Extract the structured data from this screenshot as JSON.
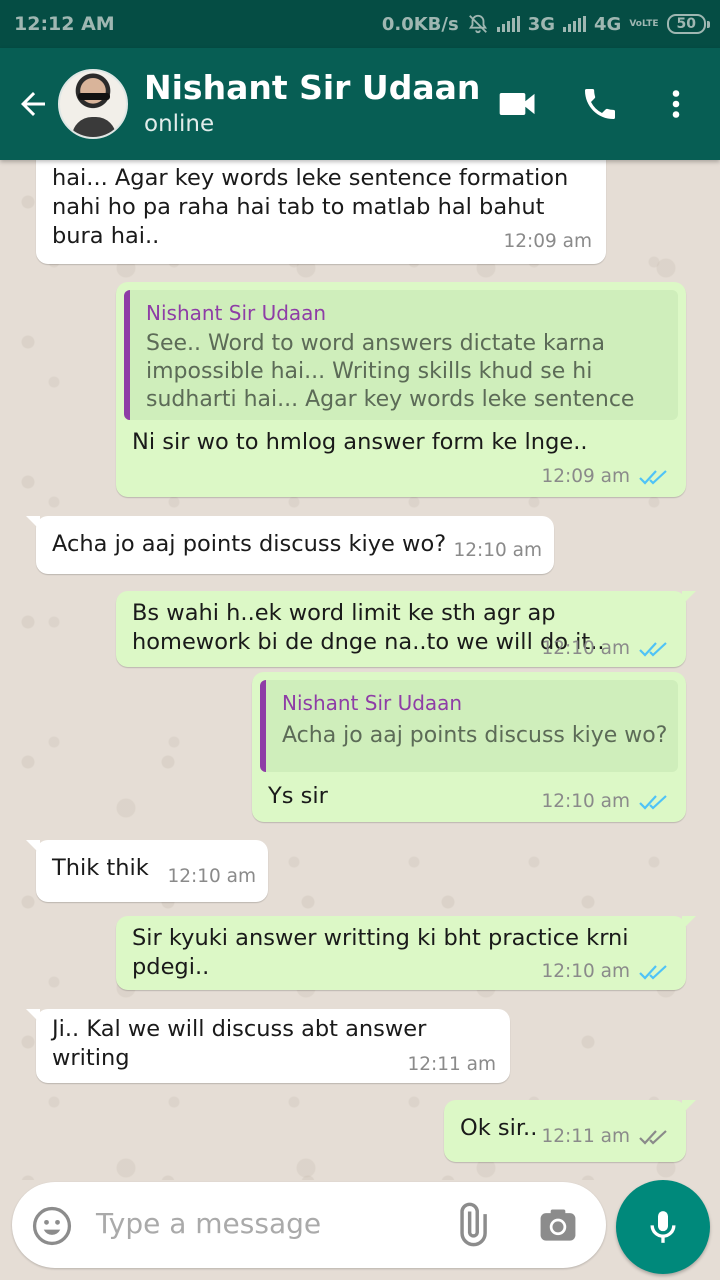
{
  "status_bar": {
    "time": "12:12 AM",
    "speed": "0.0KB/s",
    "network1": "3G",
    "network2": "4G",
    "volte": "VoLTE",
    "battery": "50"
  },
  "header": {
    "contact_name": "Nishant Sir Udaan",
    "status": "online"
  },
  "messages": [
    {
      "dir": "in",
      "text": "hai... Agar key words leke sentence formation nahi ho pa raha hai tab to matlab hal bahut bura hai..",
      "time": "12:09 am"
    },
    {
      "dir": "out",
      "quote_name": "Nishant Sir Udaan",
      "quote_text": "See.. Word to word answers dictate karna impossible hai... Writing skills khud se hi sudharti hai... Agar key words leke sentence fo...",
      "text": "Ni sir wo to hmlog answer form ke lnge..",
      "time": "12:09 am",
      "read": "read"
    },
    {
      "dir": "in",
      "text": "Acha jo aaj points discuss kiye wo?",
      "time": "12:10 am"
    },
    {
      "dir": "out",
      "text": "Bs wahi h..ek word limit ke sth agr ap homework bi de dnge na..to we will do it..",
      "time": "12:10 am",
      "read": "read"
    },
    {
      "dir": "out",
      "quote_name": "Nishant Sir Udaan",
      "quote_text": "Acha jo aaj points discuss kiye wo?",
      "text": "Ys sir",
      "time": "12:10 am",
      "read": "read"
    },
    {
      "dir": "in",
      "text": "Thik thik",
      "time": "12:10 am"
    },
    {
      "dir": "out",
      "text": "Sir kyuki answer writting ki bht practice krni pdegi..",
      "time": "12:10 am",
      "read": "read"
    },
    {
      "dir": "in",
      "text": "Ji.. Kal we will discuss abt answer writing",
      "time": "12:11 am"
    },
    {
      "dir": "out",
      "text": "Ok sir..",
      "time": "12:11 am",
      "read": "delivered"
    }
  ],
  "composer": {
    "placeholder": "Type a message"
  },
  "icons": {
    "back": "arrow-back-icon",
    "video": "video-call-icon",
    "call": "phone-icon",
    "more": "more-vert-icon",
    "emoji": "emoji-icon",
    "attach": "paperclip-icon",
    "camera": "camera-icon",
    "mic": "microphone-icon"
  },
  "colors": {
    "header": "#075e54",
    "status_bar": "#054d44",
    "outgoing_bubble": "#dcf8c6",
    "incoming_bubble": "#ffffff",
    "read_ticks": "#4fc3f7",
    "delivered_ticks": "#8a8a8a",
    "quote_accent": "#8e3da6",
    "mic_button": "#00897b"
  }
}
